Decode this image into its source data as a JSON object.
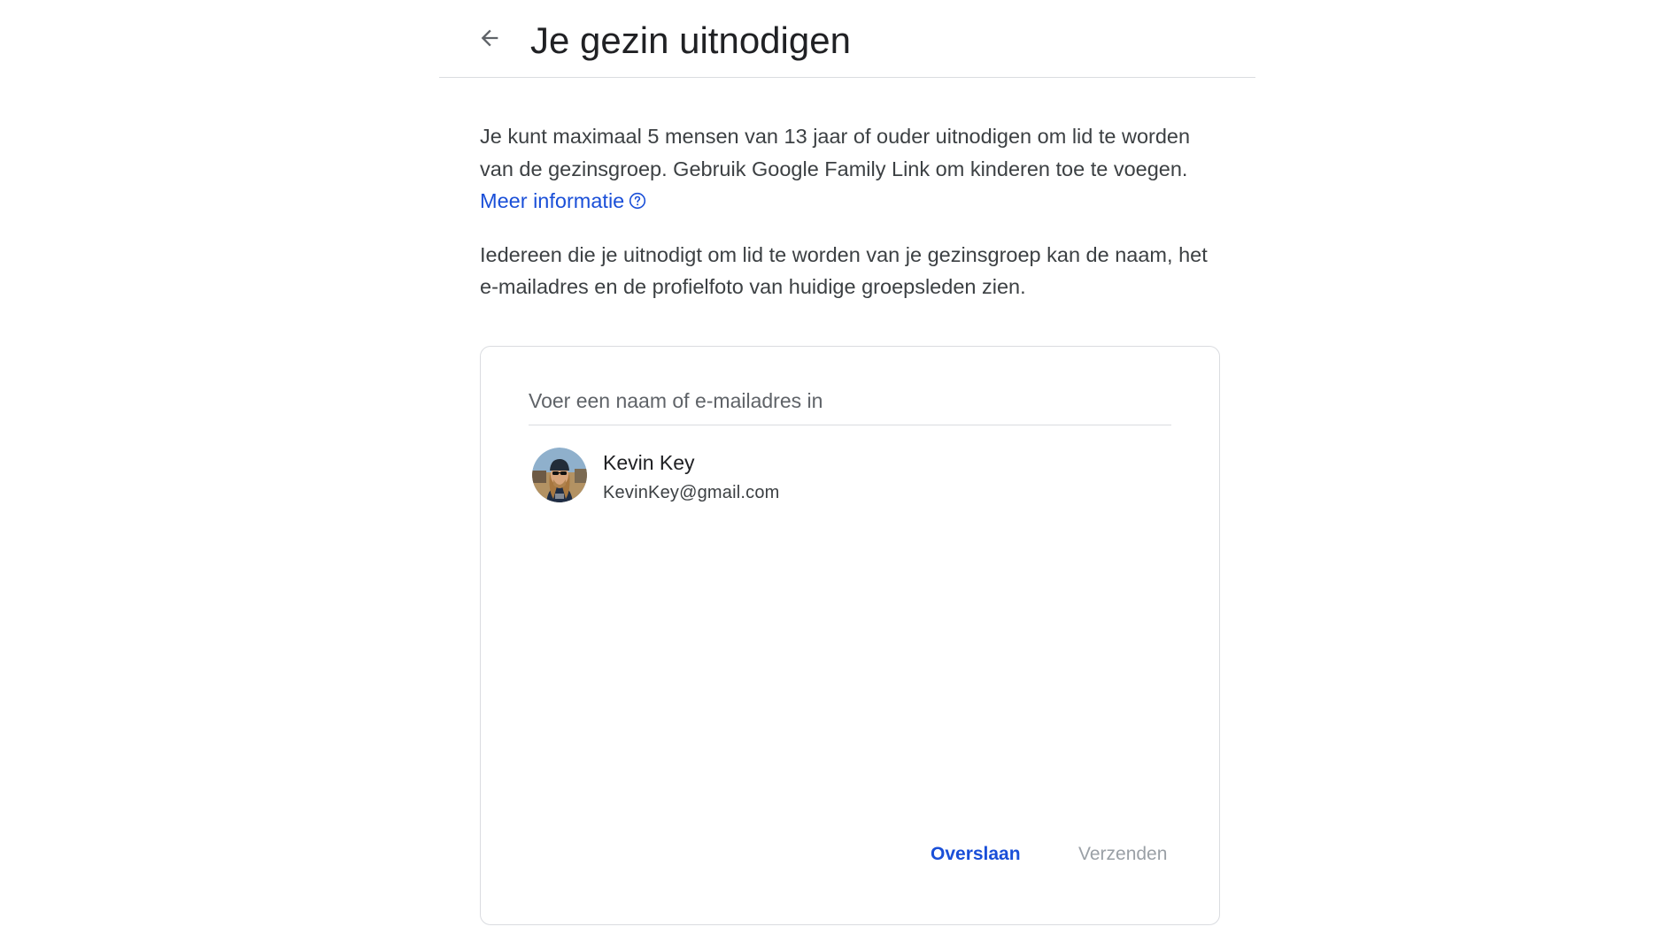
{
  "header": {
    "back_icon": "arrow-back-icon",
    "title": "Je gezin uitnodigen"
  },
  "intro": {
    "paragraph1": "Je kunt maximaal 5 mensen van 13 jaar of ouder uitnodigen om lid te worden van de gezinsgroep. Gebruik Google Family Link om kinderen toe te voegen.",
    "learn_more_link": "Meer informatie",
    "help_icon": "help-circle-icon",
    "paragraph2": "Iedereen die je uitnodigt om lid te worden van je gezinsgroep kan de naam, het e-mailadres en de profielfoto van huidige groepsleden zien."
  },
  "invite_card": {
    "search": {
      "placeholder": "Voer een naam of e-mailadres in",
      "value": ""
    },
    "suggestion": {
      "name": "Kevin Key",
      "email": "KevinKey@gmail.com",
      "avatar": "profile-photo"
    },
    "actions": {
      "skip_label": "Overslaan",
      "send_label": "Verzenden"
    }
  },
  "colors": {
    "link": "#1a4fd8",
    "disabled_text": "#9aa0a6",
    "divider": "#dadce0",
    "title_text": "#202124",
    "body_text": "#3c4043"
  }
}
